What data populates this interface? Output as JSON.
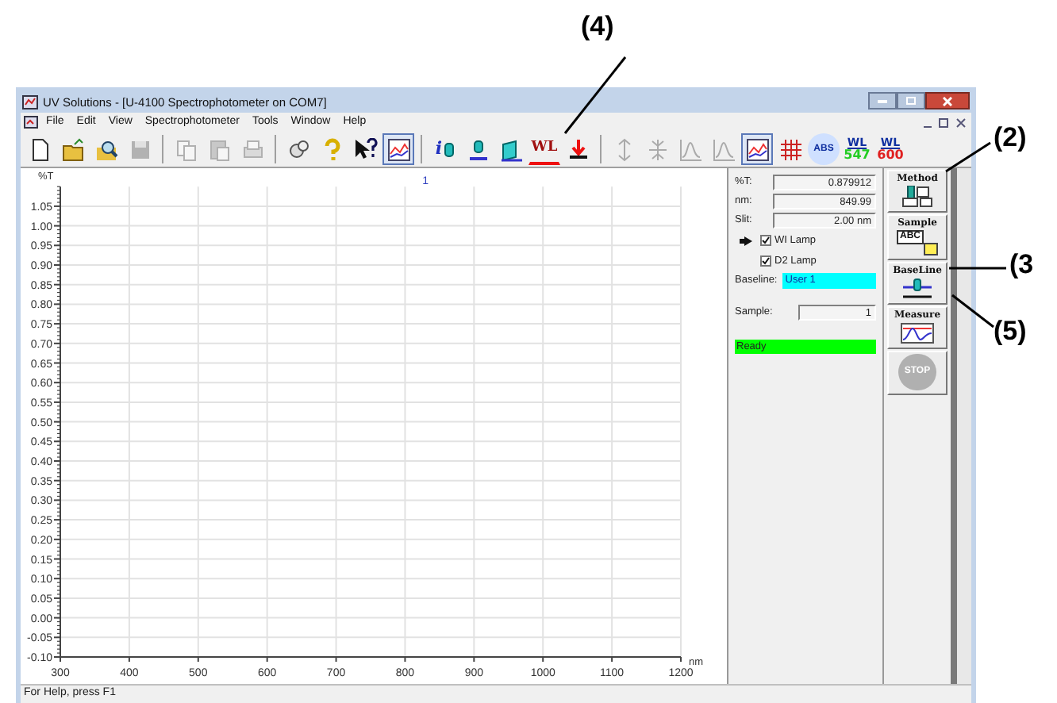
{
  "window": {
    "title": "UV Solutions - [U-4100 Spectrophotometer on COM7]"
  },
  "menu": [
    "File",
    "Edit",
    "View",
    "Spectrophotometer",
    "Tools",
    "Window",
    "Help"
  ],
  "toolbar": [
    {
      "kind": "new",
      "disabled": false,
      "pressed": false
    },
    {
      "kind": "open",
      "disabled": false,
      "pressed": false
    },
    {
      "kind": "find",
      "disabled": false,
      "pressed": false
    },
    {
      "kind": "save",
      "disabled": true,
      "pressed": false
    },
    {
      "kind": "sep"
    },
    {
      "kind": "copy",
      "disabled": true,
      "pressed": false
    },
    {
      "kind": "paste",
      "disabled": true,
      "pressed": false
    },
    {
      "kind": "print",
      "disabled": true,
      "pressed": false
    },
    {
      "kind": "sep"
    },
    {
      "kind": "tool",
      "disabled": false,
      "pressed": false
    },
    {
      "kind": "help",
      "disabled": false,
      "pressed": false
    },
    {
      "kind": "context-help",
      "disabled": false,
      "pressed": false
    },
    {
      "kind": "graph",
      "disabled": false,
      "pressed": true
    },
    {
      "kind": "sep"
    },
    {
      "kind": "info",
      "label": "i",
      "disabled": false,
      "pressed": false
    },
    {
      "kind": "lamp",
      "disabled": false,
      "pressed": false
    },
    {
      "kind": "cell",
      "disabled": false,
      "pressed": false
    },
    {
      "kind": "wl-cross",
      "label": "WL",
      "disabled": false,
      "pressed": false
    },
    {
      "kind": "zero",
      "disabled": false,
      "pressed": false
    },
    {
      "kind": "sep"
    },
    {
      "kind": "expand",
      "disabled": true,
      "pressed": false
    },
    {
      "kind": "compress",
      "disabled": true,
      "pressed": false
    },
    {
      "kind": "peak",
      "disabled": true,
      "pressed": false
    },
    {
      "kind": "peak",
      "disabled": true,
      "pressed": false
    },
    {
      "kind": "graph",
      "disabled": false,
      "pressed": true
    },
    {
      "kind": "grid",
      "disabled": false,
      "pressed": false
    },
    {
      "kind": "abs",
      "label": "ABS",
      "disabled": false,
      "pressed": false
    },
    {
      "kind": "wl",
      "label": "WL",
      "value": "547",
      "color": "#22cc22",
      "disabled": false,
      "pressed": false
    },
    {
      "kind": "wl",
      "label": "WL",
      "value": "600",
      "color": "#e02020",
      "disabled": false,
      "pressed": false
    }
  ],
  "chart": {
    "cursor_label": "1",
    "chart_data": {
      "type": "line",
      "grid": true,
      "xlabel": "nm",
      "ylabel": "%T",
      "xlim": [
        300,
        1200
      ],
      "ylim": [
        -0.1,
        1.1
      ],
      "xticks": [
        300,
        400,
        500,
        600,
        700,
        800,
        900,
        1000,
        1100,
        1200
      ],
      "yticks": [
        {
          "value": 1.05,
          "label": "1.05"
        },
        {
          "value": 1.0,
          "label": "1.00"
        },
        {
          "value": 0.95,
          "label": "0.95"
        },
        {
          "value": 0.9,
          "label": "0.90"
        },
        {
          "value": 0.85,
          "label": "0.85"
        },
        {
          "value": 0.8,
          "label": "0.80"
        },
        {
          "value": 0.75,
          "label": "0.75"
        },
        {
          "value": 0.7,
          "label": "0.70"
        },
        {
          "value": 0.65,
          "label": "0.65"
        },
        {
          "value": 0.6,
          "label": "0.60"
        },
        {
          "value": 0.55,
          "label": "0.55"
        },
        {
          "value": 0.5,
          "label": "0.50"
        },
        {
          "value": 0.45,
          "label": "0.45"
        },
        {
          "value": 0.4,
          "label": "0.40"
        },
        {
          "value": 0.35,
          "label": "0.35"
        },
        {
          "value": 0.3,
          "label": "0.30"
        },
        {
          "value": 0.25,
          "label": "0.25"
        },
        {
          "value": 0.2,
          "label": "0.20"
        },
        {
          "value": 0.15,
          "label": "0.15"
        },
        {
          "value": 0.1,
          "label": "0.10"
        },
        {
          "value": 0.05,
          "label": "0.05"
        },
        {
          "value": 0.0,
          "label": "0.00"
        },
        {
          "value": -0.05,
          "label": "-0.05"
        },
        {
          "value": -0.1,
          "label": "-0.10"
        }
      ]
    }
  },
  "panel": {
    "readings": [
      {
        "label": "%T:",
        "value": "0.879912"
      },
      {
        "label": "nm:",
        "value": "849.99"
      },
      {
        "label": "Slit:",
        "value": "2.00 nm"
      }
    ],
    "lamps": [
      {
        "label": "WI Lamp",
        "checked": true,
        "active": true
      },
      {
        "label": "D2 Lamp",
        "checked": true,
        "active": false
      }
    ],
    "baseline": {
      "label": "Baseline:",
      "value": "User 1"
    },
    "sample": {
      "label": "Sample:",
      "value": "1"
    },
    "status": "Ready"
  },
  "side_buttons": [
    {
      "kind": "method",
      "label": "Method",
      "disabled": false
    },
    {
      "kind": "sample",
      "label": "Sample",
      "icon_text": "ABC",
      "disabled": false
    },
    {
      "kind": "baseline",
      "label": "BaseLine",
      "disabled": false
    },
    {
      "kind": "measure",
      "label": "Measure",
      "disabled": false
    },
    {
      "kind": "stop",
      "label": "STOP",
      "disabled": true
    }
  ],
  "status_bar": "For Help, press F1",
  "callouts": [
    {
      "kind": "top",
      "label": "(4)"
    },
    {
      "kind": "method",
      "label": "(2)"
    },
    {
      "kind": "baseline",
      "label": "(3"
    },
    {
      "kind": "measure",
      "label": "(5)"
    }
  ]
}
